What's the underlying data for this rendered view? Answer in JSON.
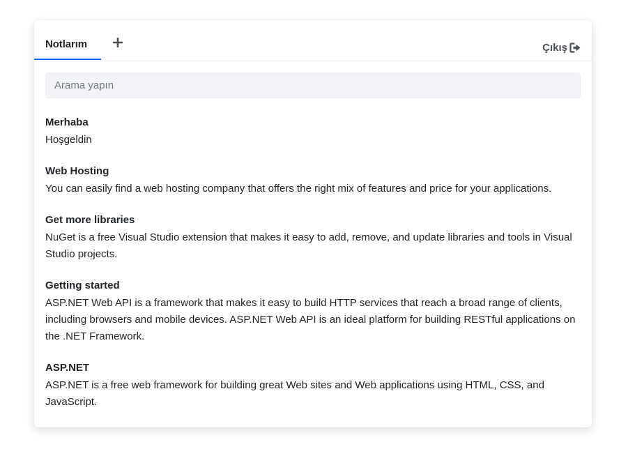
{
  "tabs": {
    "active_label": "Notlarım",
    "add_symbol": "+"
  },
  "logout": {
    "label": "Çıkış"
  },
  "search": {
    "placeholder": "Arama yapın",
    "value": ""
  },
  "notes": [
    {
      "title": "Merhaba",
      "body": "Hoşgeldin"
    },
    {
      "title": "Web Hosting",
      "body": "You can easily find a web hosting company that offers the right mix of features and price for your applications."
    },
    {
      "title": "Get more libraries",
      "body": "NuGet is a free Visual Studio extension that makes it easy to add, remove, and update libraries and tools in Visual Studio projects."
    },
    {
      "title": "Getting started",
      "body": "ASP.NET Web API is a framework that makes it easy to build HTTP services that reach a broad range of clients, including browsers and mobile devices. ASP.NET Web API is an ideal platform for building RESTful applications on the .NET Framework."
    },
    {
      "title": "ASP.NET",
      "body": "ASP.NET is a free web framework for building great Web sites and Web applications using HTML, CSS, and JavaScript."
    }
  ],
  "colors": {
    "accent": "#0d6efd",
    "text": "#212529",
    "search_bg": "#f1f3f6"
  },
  "icons": {
    "add": "plus-icon",
    "logout": "sign-out-icon"
  }
}
